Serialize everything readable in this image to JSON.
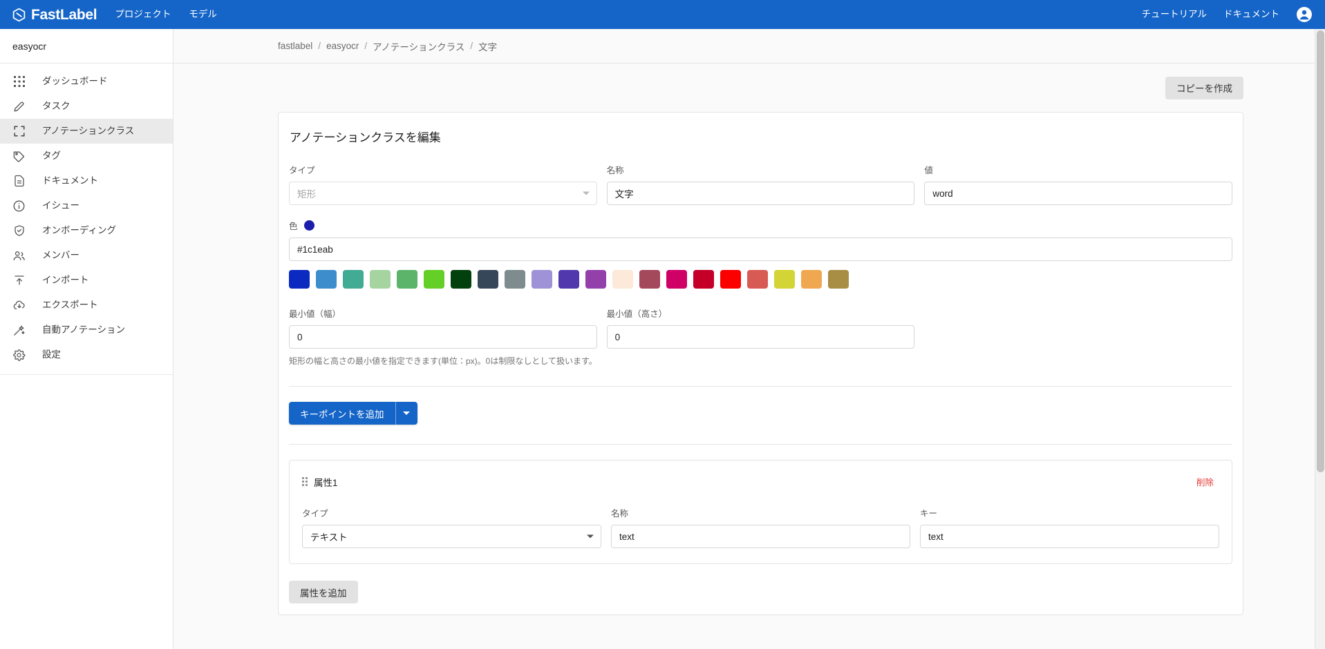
{
  "topbar": {
    "brand": "FastLabel",
    "brand_icon": "fastlabel-logo-icon",
    "nav": [
      {
        "label": "プロジェクト",
        "name": "topnav-projects"
      },
      {
        "label": "モデル",
        "name": "topnav-models"
      }
    ],
    "right_nav": [
      {
        "label": "チュートリアル",
        "name": "topnav-tutorial"
      },
      {
        "label": "ドキュメント",
        "name": "topnav-documents"
      }
    ],
    "account_icon": "account-circle-icon",
    "background": "#1565c8"
  },
  "sidebar": {
    "project_name": "easyocr",
    "items": [
      {
        "label": "ダッシュボード",
        "icon": "grid-dashboard-icon",
        "active": false
      },
      {
        "label": "タスク",
        "icon": "pencil-icon",
        "active": false
      },
      {
        "label": "アノテーションクラス",
        "icon": "crop-frame-icon",
        "active": true
      },
      {
        "label": "タグ",
        "icon": "tag-icon",
        "active": false
      },
      {
        "label": "ドキュメント",
        "icon": "document-icon",
        "active": false
      },
      {
        "label": "イシュー",
        "icon": "info-circle-icon",
        "active": false
      },
      {
        "label": "オンボーディング",
        "icon": "shield-check-icon",
        "active": false
      },
      {
        "label": "メンバー",
        "icon": "people-icon",
        "active": false
      },
      {
        "label": "インポート",
        "icon": "import-arrow-icon",
        "active": false
      },
      {
        "label": "エクスポート",
        "icon": "cloud-download-icon",
        "active": false
      },
      {
        "label": "自動アノテーション",
        "icon": "magic-wand-icon",
        "active": false
      },
      {
        "label": "設定",
        "icon": "gear-icon",
        "active": false
      }
    ]
  },
  "breadcrumb": {
    "separator": "/",
    "items": [
      "fastlabel",
      "easyocr",
      "アノテーションクラス",
      "文字"
    ]
  },
  "toolbar": {
    "copy_label": "コピーを作成"
  },
  "form": {
    "title": "アノテーションクラスを編集",
    "type": {
      "label": "タイプ",
      "value": "矩形",
      "disabled": true
    },
    "name": {
      "label": "名称",
      "value": "文字",
      "placeholder": "名称"
    },
    "value": {
      "label": "値",
      "value": "word",
      "placeholder": "値"
    },
    "color": {
      "label": "色",
      "current": "#1c1eab",
      "value_text": "#1c1eab",
      "swatches": [
        "#0a2ac0",
        "#3d8dcc",
        "#41ab93",
        "#a5d4a0",
        "#5cb46b",
        "#64cf27",
        "#02400d",
        "#37475a",
        "#7e8c8f",
        "#9f92d7",
        "#5138ad",
        "#9340ab",
        "#fce9d9",
        "#a4495c",
        "#cf0066",
        "#c40029",
        "#fc0000",
        "#d85a55",
        "#d3d435",
        "#f0a850",
        "#a88d45"
      ]
    },
    "min_width": {
      "label": "最小値（幅）",
      "value": "0",
      "placeholder": "0"
    },
    "min_height": {
      "label": "最小値（高さ）",
      "value": "0",
      "placeholder": "0"
    },
    "helper_text": "矩形の幅と高さの最小値を指定できます(単位：px)。0は制限なしとして扱います。",
    "keypoint_button": "キーポイントを追加"
  },
  "attribute": {
    "title": "属性1",
    "delete_label": "削除",
    "drag_icon": "drag-handle-icon",
    "type": {
      "label": "タイプ",
      "value": "テキスト"
    },
    "name": {
      "label": "名称",
      "value": "text",
      "placeholder": "名称"
    },
    "key": {
      "label": "キー",
      "value": "text",
      "placeholder": "キー"
    },
    "add_label": "属性を追加"
  }
}
